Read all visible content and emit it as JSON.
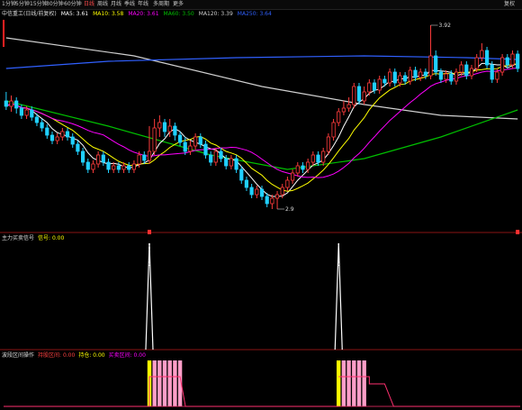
{
  "toolbar": {
    "items": [
      "1分钟",
      "5分钟",
      "15分钟",
      "30分钟",
      "60分钟",
      "日线",
      "周线",
      "月线",
      "季线",
      "年线",
      "多周期",
      "更多"
    ],
    "active_index": 5,
    "right_label": "复权"
  },
  "legend_main": {
    "title": "中信重工(日线/前复权)",
    "items": [
      {
        "label": "MA5: 3.61",
        "color": "#ffffff"
      },
      {
        "label": "MA10: 3.58",
        "color": "#ffff00"
      },
      {
        "label": "MA20: 3.61",
        "color": "#ff00ff"
      },
      {
        "label": "MA60: 3.50",
        "color": "#00c000"
      },
      {
        "label": "MA120: 3.39",
        "color": "#d0d0d0"
      },
      {
        "label": "MA250: 3.64",
        "color": "#3060ff"
      }
    ]
  },
  "panel2": {
    "title": "主力买卖信号",
    "items": [
      {
        "label": "信号: 0.00",
        "color": "#ffff00"
      }
    ]
  },
  "panel3": {
    "title": "波段区间操作",
    "items": [
      {
        "label": "持股区间: 0.00",
        "color": "#ff4040"
      },
      {
        "label": "持仓: 0.00",
        "color": "#ffff00"
      },
      {
        "label": "买卖区间: 0.00",
        "color": "#ff00ff"
      }
    ]
  },
  "colors": {
    "bull": "#ff3c3c",
    "bear": "#20d0ff",
    "grid": "#7a1010"
  },
  "chart_data": {
    "type": "candlestick",
    "ylim": [
      2.8,
      3.95
    ],
    "annotations": [
      {
        "label": "3.92",
        "index": 83,
        "value": 3.92
      },
      {
        "label": "2.9",
        "index": 53,
        "value": 2.9
      }
    ],
    "candles": [
      [
        3.5,
        3.47,
        3.55,
        3.45
      ],
      [
        3.47,
        3.5,
        3.53,
        3.44
      ],
      [
        3.5,
        3.46,
        3.52,
        3.43
      ],
      [
        3.46,
        3.42,
        3.48,
        3.4
      ],
      [
        3.42,
        3.45,
        3.47,
        3.4
      ],
      [
        3.45,
        3.41,
        3.47,
        3.39
      ],
      [
        3.41,
        3.38,
        3.43,
        3.36
      ],
      [
        3.38,
        3.35,
        3.4,
        3.33
      ],
      [
        3.35,
        3.31,
        3.37,
        3.29
      ],
      [
        3.31,
        3.28,
        3.33,
        3.26
      ],
      [
        3.28,
        3.3,
        3.32,
        3.26
      ],
      [
        3.3,
        3.33,
        3.35,
        3.28
      ],
      [
        3.33,
        3.3,
        3.35,
        3.28
      ],
      [
        3.3,
        3.26,
        3.32,
        3.24
      ],
      [
        3.26,
        3.22,
        3.28,
        3.2
      ],
      [
        3.22,
        3.16,
        3.24,
        3.14
      ],
      [
        3.16,
        3.12,
        3.18,
        3.1
      ],
      [
        3.12,
        3.15,
        3.17,
        3.1
      ],
      [
        3.15,
        3.2,
        3.22,
        3.13
      ],
      [
        3.2,
        3.16,
        3.22,
        3.14
      ],
      [
        3.16,
        3.12,
        3.18,
        3.1
      ],
      [
        3.12,
        3.14,
        3.16,
        3.1
      ],
      [
        3.14,
        3.12,
        3.16,
        3.1
      ],
      [
        3.12,
        3.14,
        3.16,
        3.1
      ],
      [
        3.14,
        3.12,
        3.16,
        3.1
      ],
      [
        3.12,
        3.15,
        3.17,
        3.1
      ],
      [
        3.15,
        3.2,
        3.22,
        3.13
      ],
      [
        3.2,
        3.17,
        3.22,
        3.15
      ],
      [
        3.17,
        3.22,
        3.36,
        3.15
      ],
      [
        3.22,
        3.35,
        3.4,
        3.2
      ],
      [
        3.35,
        3.38,
        3.42,
        3.3
      ],
      [
        3.38,
        3.33,
        3.4,
        3.3
      ],
      [
        3.33,
        3.36,
        3.4,
        3.3
      ],
      [
        3.36,
        3.31,
        3.38,
        3.28
      ],
      [
        3.31,
        3.27,
        3.33,
        3.25
      ],
      [
        3.27,
        3.22,
        3.3,
        3.2
      ],
      [
        3.22,
        3.25,
        3.28,
        3.2
      ],
      [
        3.25,
        3.3,
        3.32,
        3.23
      ],
      [
        3.3,
        3.26,
        3.32,
        3.24
      ],
      [
        3.26,
        3.2,
        3.28,
        3.18
      ],
      [
        3.2,
        3.16,
        3.22,
        3.14
      ],
      [
        3.16,
        3.22,
        3.24,
        3.14
      ],
      [
        3.22,
        3.18,
        3.24,
        3.16
      ],
      [
        3.18,
        3.14,
        3.2,
        3.12
      ],
      [
        3.14,
        3.18,
        3.2,
        3.12
      ],
      [
        3.18,
        3.12,
        3.2,
        3.1
      ],
      [
        3.12,
        3.06,
        3.14,
        3.04
      ],
      [
        3.06,
        3.02,
        3.08,
        3.0
      ],
      [
        3.02,
        2.98,
        3.04,
        2.96
      ],
      [
        2.98,
        3.01,
        3.03,
        2.96
      ],
      [
        3.01,
        2.97,
        3.03,
        2.95
      ],
      [
        2.97,
        2.93,
        2.99,
        2.91
      ],
      [
        2.93,
        2.96,
        2.98,
        2.9
      ],
      [
        2.96,
        2.98,
        3.0,
        2.9
      ],
      [
        2.98,
        3.02,
        3.04,
        2.96
      ],
      [
        3.02,
        3.06,
        3.08,
        3.0
      ],
      [
        3.06,
        3.1,
        3.12,
        3.04
      ],
      [
        3.1,
        3.14,
        3.16,
        3.08
      ],
      [
        3.14,
        3.12,
        3.16,
        3.1
      ],
      [
        3.12,
        3.16,
        3.18,
        3.1
      ],
      [
        3.16,
        3.2,
        3.22,
        3.14
      ],
      [
        3.2,
        3.16,
        3.22,
        3.14
      ],
      [
        3.16,
        3.22,
        3.24,
        3.14
      ],
      [
        3.22,
        3.3,
        3.32,
        3.2
      ],
      [
        3.3,
        3.38,
        3.4,
        3.28
      ],
      [
        3.38,
        3.44,
        3.46,
        3.36
      ],
      [
        3.44,
        3.46,
        3.5,
        3.42
      ],
      [
        3.46,
        3.48,
        3.52,
        3.44
      ],
      [
        3.48,
        3.58,
        3.6,
        3.46
      ],
      [
        3.58,
        3.5,
        3.6,
        3.48
      ],
      [
        3.5,
        3.55,
        3.58,
        3.48
      ],
      [
        3.55,
        3.6,
        3.62,
        3.53
      ],
      [
        3.6,
        3.56,
        3.62,
        3.54
      ],
      [
        3.56,
        3.62,
        3.64,
        3.54
      ],
      [
        3.62,
        3.6,
        3.64,
        3.58
      ],
      [
        3.6,
        3.66,
        3.68,
        3.58
      ],
      [
        3.66,
        3.6,
        3.68,
        3.58
      ],
      [
        3.6,
        3.64,
        3.66,
        3.58
      ],
      [
        3.64,
        3.61,
        3.66,
        3.59
      ],
      [
        3.61,
        3.67,
        3.69,
        3.59
      ],
      [
        3.67,
        3.63,
        3.69,
        3.61
      ],
      [
        3.63,
        3.66,
        3.68,
        3.61
      ],
      [
        3.66,
        3.64,
        3.68,
        3.62
      ],
      [
        3.64,
        3.75,
        3.92,
        3.62
      ],
      [
        3.75,
        3.66,
        3.78,
        3.64
      ],
      [
        3.66,
        3.62,
        3.68,
        3.6
      ],
      [
        3.62,
        3.65,
        3.67,
        3.6
      ],
      [
        3.65,
        3.61,
        3.67,
        3.59
      ],
      [
        3.61,
        3.66,
        3.68,
        3.59
      ],
      [
        3.66,
        3.7,
        3.72,
        3.64
      ],
      [
        3.7,
        3.64,
        3.72,
        3.62
      ],
      [
        3.64,
        3.68,
        3.7,
        3.62
      ],
      [
        3.68,
        3.74,
        3.76,
        3.66
      ],
      [
        3.74,
        3.78,
        3.82,
        3.72
      ],
      [
        3.78,
        3.7,
        3.8,
        3.68
      ],
      [
        3.7,
        3.62,
        3.72,
        3.6
      ],
      [
        3.62,
        3.66,
        3.68,
        3.6
      ],
      [
        3.66,
        3.74,
        3.76,
        3.64
      ],
      [
        3.74,
        3.7,
        3.76,
        3.68
      ],
      [
        3.7,
        3.76,
        3.78,
        3.68
      ],
      [
        3.76,
        3.68,
        3.78,
        3.66
      ]
    ],
    "long_ma": {
      "MA60": {
        "start": 3.5,
        "path": [
          [
            0,
            3.5
          ],
          [
            20,
            3.36
          ],
          [
            40,
            3.2
          ],
          [
            55,
            3.12
          ],
          [
            70,
            3.18
          ],
          [
            85,
            3.3
          ],
          [
            100,
            3.45
          ]
        ]
      },
      "MA120": {
        "start": 3.85,
        "path": [
          [
            0,
            3.85
          ],
          [
            25,
            3.75
          ],
          [
            50,
            3.58
          ],
          [
            70,
            3.48
          ],
          [
            85,
            3.42
          ],
          [
            100,
            3.4
          ]
        ]
      },
      "MA250": {
        "start": 3.68,
        "path": [
          [
            0,
            3.68
          ],
          [
            20,
            3.72
          ],
          [
            45,
            3.74
          ],
          [
            70,
            3.75
          ],
          [
            90,
            3.74
          ],
          [
            100,
            3.73
          ]
        ]
      }
    },
    "signal_panel": {
      "type": "spike",
      "spikes": [
        28,
        65
      ],
      "ylim": [
        0,
        1
      ]
    },
    "band_panel": {
      "type": "bar",
      "hold_ranges": [
        [
          28,
          34
        ],
        [
          65,
          70
        ]
      ],
      "step_start": 71,
      "step_end": 74
    }
  }
}
